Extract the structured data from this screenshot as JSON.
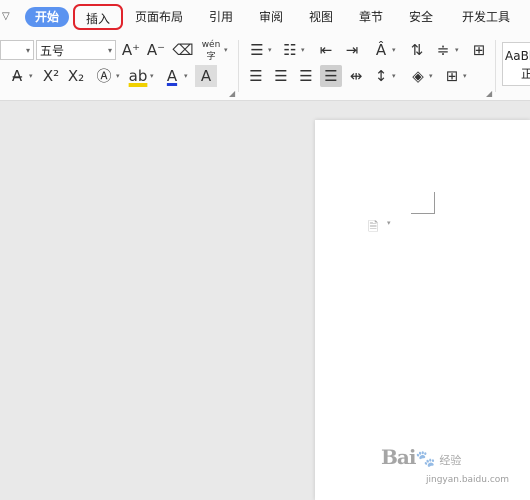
{
  "tabs": [
    {
      "label": "开始"
    },
    {
      "label": "插入"
    },
    {
      "label": "页面布局"
    },
    {
      "label": "引用"
    },
    {
      "label": "审阅"
    },
    {
      "label": "视图"
    },
    {
      "label": "章节"
    },
    {
      "label": "安全"
    },
    {
      "label": "开发工具"
    }
  ],
  "active_tab": "开始",
  "highlighted_tab": "插入",
  "ribbon": {
    "font_size_value": "五号",
    "grow_font_label": "A⁺",
    "shrink_font_label": "A⁻",
    "pinyin_label": "wén",
    "style_preview": "AaBl",
    "style_preview_name": "正"
  },
  "watermark": {
    "brand": "Bai",
    "paw": "🐾",
    "brand2": "经验",
    "url": "jingyan.baidu.com"
  },
  "colors": {
    "accent": "#5b93f0",
    "highlight_box": "#e0242c",
    "font_color": "#1f3cd8",
    "highlight_color": "#f0d000"
  }
}
